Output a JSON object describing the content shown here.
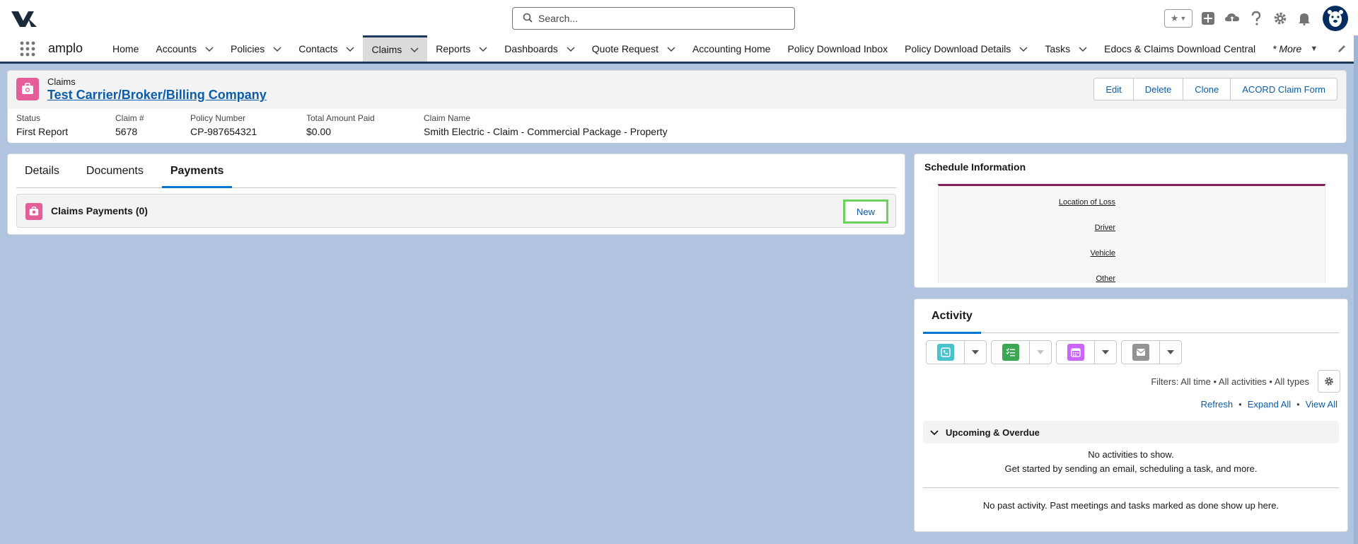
{
  "header": {
    "search_placeholder": "Search..."
  },
  "nav": {
    "app_name": "amplo",
    "items": [
      {
        "label": "Home",
        "has_menu": false
      },
      {
        "label": "Accounts",
        "has_menu": true
      },
      {
        "label": "Policies",
        "has_menu": true
      },
      {
        "label": "Contacts",
        "has_menu": true
      },
      {
        "label": "Claims",
        "has_menu": true,
        "active": true
      },
      {
        "label": "Reports",
        "has_menu": true
      },
      {
        "label": "Dashboards",
        "has_menu": true
      },
      {
        "label": "Quote Request",
        "has_menu": true
      },
      {
        "label": "Accounting Home",
        "has_menu": false
      },
      {
        "label": "Policy Download Inbox",
        "has_menu": false
      },
      {
        "label": "Policy Download Details",
        "has_menu": true
      },
      {
        "label": "Tasks",
        "has_menu": true
      },
      {
        "label": "Edocs & Claims Download Central",
        "has_menu": false
      }
    ],
    "more_label": "* More"
  },
  "record": {
    "object_label": "Claims",
    "title": "Test Carrier/Broker/Billing Company",
    "buttons": [
      "Edit",
      "Delete",
      "Clone",
      "ACORD Claim Form"
    ],
    "fields": [
      {
        "label": "Status",
        "value": "First Report"
      },
      {
        "label": "Claim #",
        "value": "5678"
      },
      {
        "label": "Policy Number",
        "value": "CP-987654321"
      },
      {
        "label": "Total Amount Paid",
        "value": "$0.00"
      },
      {
        "label": "Claim Name",
        "value": "Smith Electric - Claim - Commercial Package - Property"
      }
    ]
  },
  "tabs": [
    "Details",
    "Documents",
    "Payments"
  ],
  "active_tab": "Payments",
  "related_list": {
    "title": "Claims Payments (0)",
    "new_label": "New"
  },
  "schedule": {
    "title": "Schedule Information",
    "links": [
      "Location of Loss",
      "Driver",
      "Vehicle",
      "Other"
    ]
  },
  "activity": {
    "tab_label": "Activity",
    "filters": "Filters: All time • All activities • All types",
    "refresh": "Refresh",
    "expand_all": "Expand All",
    "view_all": "View All",
    "upcoming_label": "Upcoming & Overdue",
    "no_activities": "No activities to show.",
    "get_started": "Get started by sending an email, scheduling a task, and more.",
    "no_past": "No past activity. Past meetings and tasks marked as done show up here."
  },
  "colors": {
    "brand_blue": "#0b5cab",
    "claims_icon": "#e55e99",
    "call_icon": "#48c3cc",
    "task_icon": "#3ba755",
    "event_icon": "#cb65ff",
    "email_icon": "#939393",
    "highlight_green": "#6bd35c",
    "nav_accent": "#1b3a5c",
    "page_bg": "#b0c4df"
  }
}
